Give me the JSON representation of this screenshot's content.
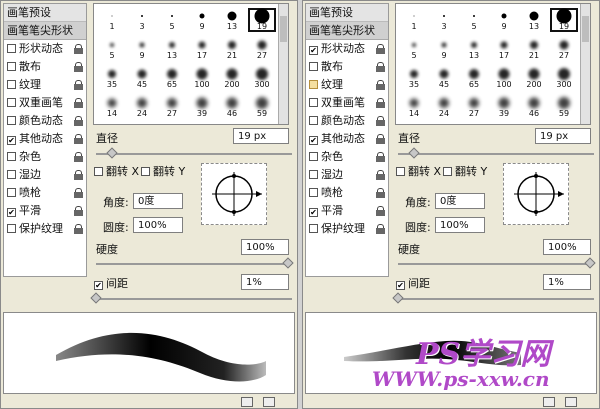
{
  "panels": [
    {
      "side": {
        "presets_label": "画笔预设",
        "tip_label": "画笔笔尖形状",
        "options": [
          {
            "label": "形状动态",
            "checked": false,
            "highlight": false
          },
          {
            "label": "散布",
            "checked": false,
            "highlight": false
          },
          {
            "label": "纹理",
            "checked": false,
            "highlight": false
          },
          {
            "label": "双重画笔",
            "checked": false,
            "highlight": false
          },
          {
            "label": "颜色动态",
            "checked": false,
            "highlight": false
          },
          {
            "label": "其他动态",
            "checked": true,
            "highlight": false
          },
          {
            "label": "杂色",
            "checked": false,
            "highlight": false
          },
          {
            "label": "湿边",
            "checked": false,
            "highlight": false
          },
          {
            "label": "喷枪",
            "checked": false,
            "highlight": false
          },
          {
            "label": "平滑",
            "checked": true,
            "highlight": false
          },
          {
            "label": "保护纹理",
            "checked": false,
            "highlight": false
          }
        ]
      },
      "controls": {
        "diameter_label": "直径",
        "diameter_value": "19 px",
        "flip_x_label": "翻转 X",
        "flip_y_label": "翻转 Y",
        "angle_label": "角度:",
        "angle_value": "0度",
        "roundness_label": "圆度:",
        "roundness_value": "100%",
        "hardness_label": "硬度",
        "hardness_value": "100%",
        "spacing_label": "间距",
        "spacing_value": "1%"
      }
    },
    {
      "side": {
        "presets_label": "画笔预设",
        "tip_label": "画笔笔尖形状",
        "options": [
          {
            "label": "形状动态",
            "checked": true,
            "highlight": false
          },
          {
            "label": "散布",
            "checked": false,
            "highlight": false
          },
          {
            "label": "纹理",
            "checked": false,
            "highlight": true
          },
          {
            "label": "双重画笔",
            "checked": false,
            "highlight": false
          },
          {
            "label": "颜色动态",
            "checked": false,
            "highlight": false
          },
          {
            "label": "其他动态",
            "checked": true,
            "highlight": false
          },
          {
            "label": "杂色",
            "checked": false,
            "highlight": false
          },
          {
            "label": "湿边",
            "checked": false,
            "highlight": false
          },
          {
            "label": "喷枪",
            "checked": false,
            "highlight": false
          },
          {
            "label": "平滑",
            "checked": true,
            "highlight": false
          },
          {
            "label": "保护纹理",
            "checked": false,
            "highlight": false
          }
        ]
      },
      "controls": {
        "diameter_label": "直径",
        "diameter_value": "19 px",
        "flip_x_label": "翻转 X",
        "flip_y_label": "翻转 Y",
        "angle_label": "角度:",
        "angle_value": "0度",
        "roundness_label": "圆度:",
        "roundness_value": "100%",
        "hardness_label": "硬度",
        "hardness_value": "100%",
        "spacing_label": "间距",
        "spacing_value": "1%"
      }
    }
  ],
  "brush_sizes": [
    [
      "1",
      "3",
      "5",
      "9",
      "13",
      "19"
    ],
    [
      "5",
      "9",
      "13",
      "17",
      "21",
      "27"
    ],
    [
      "35",
      "45",
      "65",
      "100",
      "200",
      "300"
    ],
    [
      "14",
      "24",
      "27",
      "39",
      "46",
      "59"
    ]
  ],
  "selected_brush": "19",
  "watermark": {
    "line1": "PS学习网",
    "line2": "WWW.ps-xxw.cn"
  },
  "colors": {
    "watermark": "#b049c8",
    "panel_bg": "#ece9d8",
    "checkbox_highlight": "#f5dfa0"
  }
}
